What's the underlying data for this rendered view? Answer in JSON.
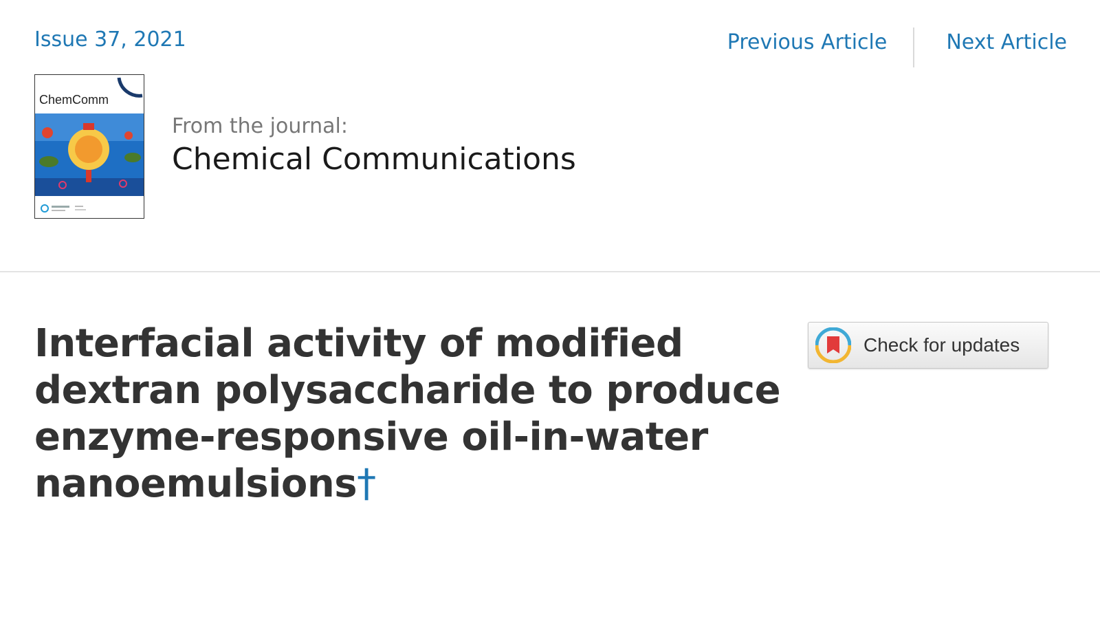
{
  "header": {
    "issue_label": "Issue 37, 2021",
    "previous_article": "Previous Article",
    "next_article": "Next Article"
  },
  "journal": {
    "cover_title": "ChemComm",
    "from_label": "From the journal:",
    "name": "Chemical Communications"
  },
  "article": {
    "title": "Interfacial activity of modified dextran polysaccharide to produce enzyme-responsive oil-in-water nanoemulsions",
    "footnote_marker": "†"
  },
  "actions": {
    "check_updates_label": "Check for updates"
  },
  "colors": {
    "link": "#1f78b4",
    "title_text": "#333333",
    "divider": "#e3e3e3"
  },
  "icons": {
    "check_updates": "crossmark-bookmark-icon"
  }
}
